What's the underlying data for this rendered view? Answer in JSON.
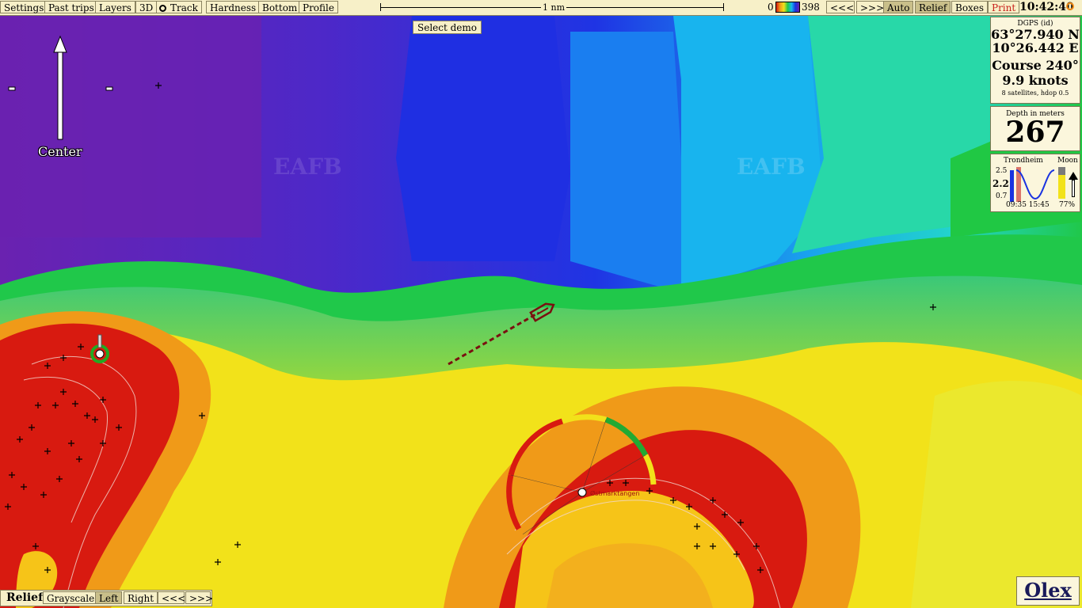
{
  "toolbar": {
    "settings": "Settings",
    "past_trips": "Past trips",
    "layers": "Layers",
    "three_d": "3D",
    "track": "Track",
    "hardness": "Hardness",
    "bottom": "Bottom",
    "profile": "Profile",
    "scale_label": "1 nm",
    "depth_min": "0",
    "depth_max": "398",
    "prev": "<<<",
    "next": ">>>",
    "auto": "Auto",
    "relief": "Relief",
    "boxes": "Boxes",
    "print": "Print",
    "clock": "10:42:40"
  },
  "demo_button": "Select demo",
  "center_label": "Center",
  "gps": {
    "source": "DGPS (id)",
    "lat": "63°27.940 N",
    "lon": "10°26.442 E",
    "course": "Course 240°",
    "speed": "9.9 knots",
    "satellites": "8 satellites, hdop 0.5"
  },
  "depth": {
    "label": "Depth in meters",
    "value": "267"
  },
  "tide": {
    "place": "Trondheim",
    "moon_label": "Moon",
    "high": "2.5",
    "current": "2.2",
    "low": "0.7",
    "times": "09:35 15:45",
    "moon_pct": "77%"
  },
  "place_label": "Østmarktangen",
  "watermark": "EAFB",
  "bottombar": {
    "relief": "Relief",
    "grayscale": "Grayscale",
    "left": "Left",
    "right": "Right",
    "prev": "<<<",
    "next": ">>>"
  },
  "logo": "Olex",
  "colors": {
    "deep": "#6a1fa8",
    "blue": "#1a33e0",
    "cyan": "#18b8ee",
    "green": "#18c840",
    "yellow": "#f2e21a",
    "orange": "#f08a14",
    "red": "#d81a10"
  }
}
